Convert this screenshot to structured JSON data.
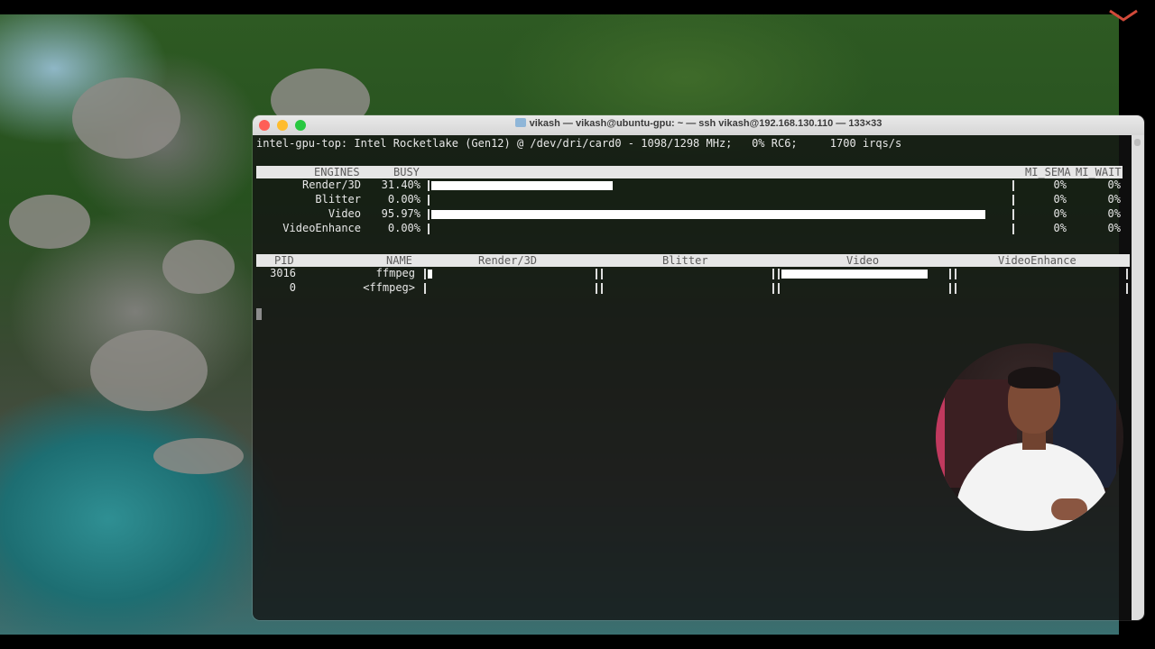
{
  "window": {
    "title": "vikash — vikash@ubuntu-gpu: ~ — ssh vikash@192.168.130.110 — 133×33"
  },
  "topbar": {
    "text": "intel-gpu-top: Intel Rocketlake (Gen12) @ /dev/dri/card0 - 1098/1298 MHz;   0% RC6;     1700 irqs/s"
  },
  "engines": {
    "headers": [
      "ENGINES",
      "BUSY",
      "MI_SEMA",
      "MI_WAIT"
    ],
    "rows": [
      {
        "name": "Render/3D",
        "busy": "31.40%",
        "busy_value": 31.4,
        "sema": "0%",
        "wait": "0%"
      },
      {
        "name": "Blitter",
        "busy": "0.00%",
        "busy_value": 0.0,
        "sema": "0%",
        "wait": "0%"
      },
      {
        "name": "Video",
        "busy": "95.97%",
        "busy_value": 95.97,
        "sema": "0%",
        "wait": "0%"
      },
      {
        "name": "VideoEnhance",
        "busy": "0.00%",
        "busy_value": 0.0,
        "sema": "0%",
        "wait": "0%"
      }
    ]
  },
  "clients": {
    "headers": [
      "PID",
      "NAME",
      "Render/3D",
      "Blitter",
      "Video",
      "VideoEnhance"
    ],
    "rows": [
      {
        "pid": "3016",
        "name": "ffmpeg",
        "render": 0.03,
        "blitter": 0,
        "video": 0.9,
        "enhance": 0
      },
      {
        "pid": "0",
        "name": "<ffmpeg>",
        "render": 0,
        "blitter": 0,
        "video": 0,
        "enhance": 0
      }
    ]
  },
  "colors": {
    "terminal_bg": "#121212",
    "header_bg": "#e6e6e6",
    "bar": "#ffffff"
  }
}
